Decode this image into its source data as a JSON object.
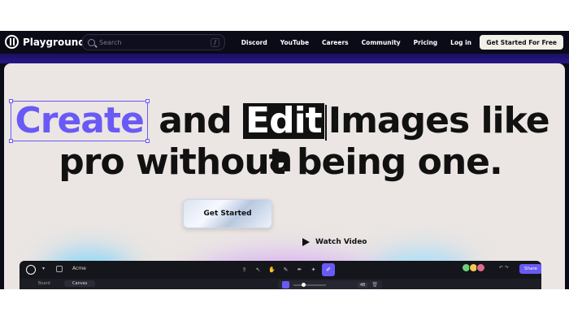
{
  "nav": {
    "brand": "Playground",
    "search_placeholder": "Search",
    "search_shortcut": "/",
    "links": [
      "Discord",
      "YouTube",
      "Careers",
      "Community",
      "Pricing",
      "Log in"
    ],
    "cta": "Get Started For Free"
  },
  "hero": {
    "word_create": "Create",
    "word_and": "and",
    "word_edit": "Edit",
    "line1_rest": "Images like a",
    "line2": "pro without being one.",
    "primary_button": "Get Started",
    "secondary_button": "Watch Video"
  },
  "editor": {
    "project_name": "Acme",
    "tabs": [
      "Board",
      "Canvas"
    ],
    "brush_size": "48",
    "share_label": "Share"
  },
  "colors": {
    "accent": "#6a5af5",
    "nav_bg": "#0b0a17",
    "hero_bg": "#ebe6e3"
  }
}
